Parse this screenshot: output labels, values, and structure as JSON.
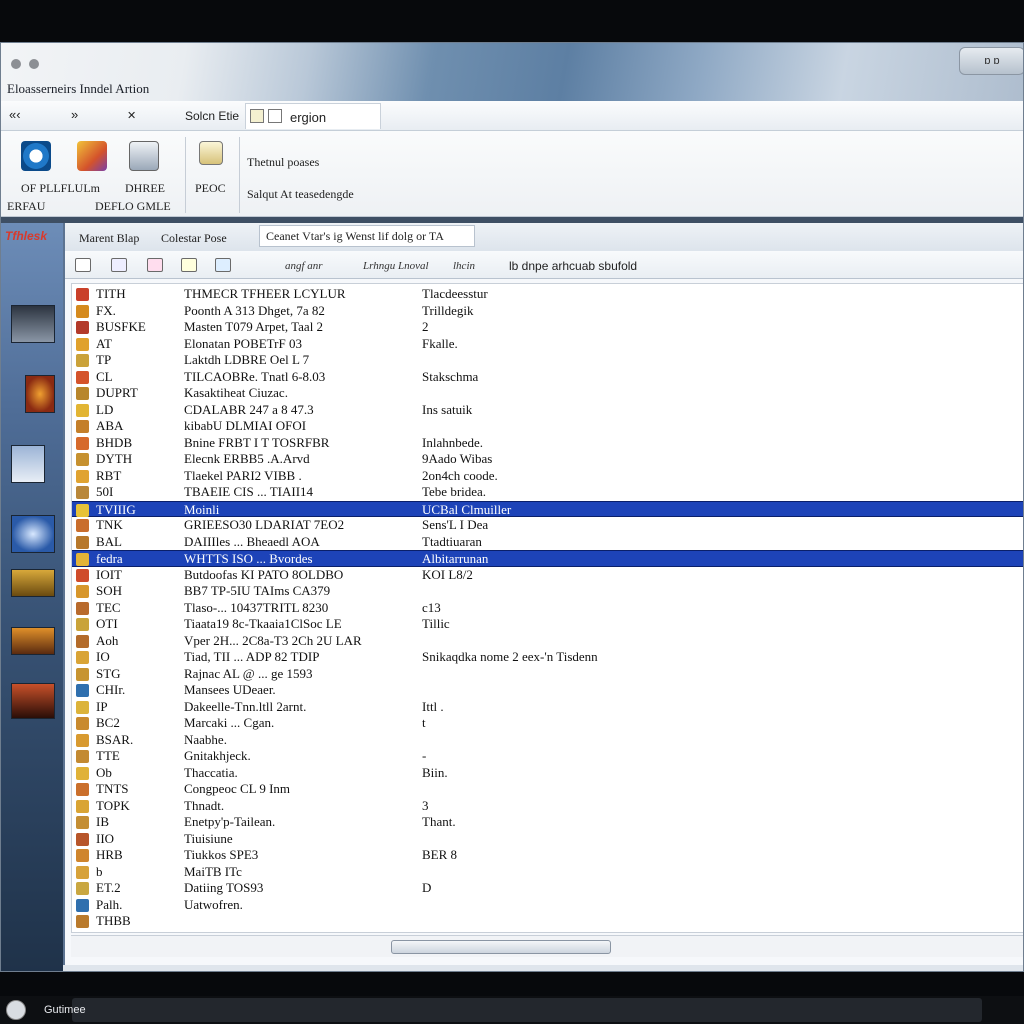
{
  "window": {
    "title": "Eloasserneirs Inndel Artion",
    "controls": "ɒ ɒ"
  },
  "navbar": {
    "back": "«‹",
    "forward": "»",
    "menu": "✕",
    "label": "Solcn Etie",
    "address": "ergion"
  },
  "ribbon": {
    "groups": [
      {
        "label1": "OF PLLFLULm",
        "label2": "ERFAU"
      },
      {
        "label1": "DHREE",
        "label2": "DEFLO GMLE"
      }
    ],
    "mid_label": "PEOC",
    "line1": "Thetnul poases",
    "line2": "Salqut At teasedengde"
  },
  "desktop": {
    "logo": "Tfhlesk"
  },
  "panel": {
    "tabs": [
      "Marent Blap",
      "Colestar Pose"
    ],
    "search": "Ceanet Vtar's ig Wenst lif dolg or TA",
    "tool_labels": [
      "angf anr",
      "Lrhngu Lnoval",
      "lhcin"
    ],
    "tool_right": "lb dnpe arhcuab sbufold"
  },
  "rows": [
    {
      "icon": "#c9402a",
      "c1": "TITH",
      "c2": "THMECR TFHEER LCYLUR",
      "c3": "Tlacdeesstur",
      "selected": false
    },
    {
      "icon": "#d58a1e",
      "c1": "FX.",
      "c2": "Poonth A 313 Dhget, 7a 82",
      "c3": "Trilldegik",
      "selected": false
    },
    {
      "icon": "#b33a2a",
      "c1": "BUSFKE",
      "c2": "Masten T079 Arpet, Taal 2",
      "c3": "2",
      "selected": false
    },
    {
      "icon": "#e0a12c",
      "c1": "AT",
      "c2": "Elonatan POBETrF 03",
      "c3": "Fkalle.",
      "selected": false
    },
    {
      "icon": "#caa23a",
      "c1": "TP",
      "c2": "Laktdh LDBRE Oel L 7",
      "c3": "",
      "selected": false
    },
    {
      "icon": "#d4532b",
      "c1": "CL",
      "c2": "TILCAOBRe. Tnatl 6-8.03",
      "c3": "Stakschma",
      "selected": false
    },
    {
      "icon": "#b8862c",
      "c1": "DUPRT",
      "c2": "Kasaktiheat Ciuzac.",
      "c3": "",
      "selected": false
    },
    {
      "icon": "#e2b534",
      "c1": "LD",
      "c2": "CDALABR 247 a 8 47.3",
      "c3": "Ins satuik",
      "selected": false
    },
    {
      "icon": "#c47f2a",
      "c1": "ABA",
      "c2": "kibabU DLMIAI OFOI",
      "c3": "",
      "selected": false
    },
    {
      "icon": "#d66a2c",
      "c1": "BHDB",
      "c2": "Bnine FRBT I T TOSRFBR",
      "c3": "Inlahnbede.",
      "selected": false
    },
    {
      "icon": "#c69130",
      "c1": "DYTH",
      "c2": "Elecnk ERBB5 .A.Arvd",
      "c3": "9Aado Wibas",
      "selected": false
    },
    {
      "icon": "#e0a331",
      "c1": "RBT",
      "c2": "Tlaekel PARI2 VIBB .",
      "c3": "2on4ch coode.",
      "selected": false
    },
    {
      "icon": "#b9873a",
      "c1": "50I",
      "c2": "TBAEIE CIS ... TIAII14",
      "c3": "Tebe bridea.",
      "selected": false
    },
    {
      "icon": "#e7c238",
      "c1": "TVIIIG",
      "c2": "Moinli",
      "c3": "UCBal Clmuiller",
      "selected": true
    },
    {
      "icon": "#c96d2c",
      "c1": "TNK",
      "c2": "GRIEESO30 LDARIAT 7EO2",
      "c3": "Sens'L I Dea",
      "selected": false
    },
    {
      "icon": "#b7782b",
      "c1": "BAL",
      "c2": "DAIIIles ... Bheaedl AOA",
      "c3": "Ttadtiuaran",
      "selected": false
    },
    {
      "icon": "#e3b337",
      "c1": "fedra",
      "c2": "WHTTS ISO ... Bvordes",
      "c3": "Albitarrunan",
      "selected": true
    },
    {
      "icon": "#cf4c2b",
      "c1": "IOIT",
      "c2": "Butdoofas KI PATO 8OLDBO",
      "c3": "KOI L8/2",
      "selected": false
    },
    {
      "icon": "#d7962b",
      "c1": "SOH",
      "c2": "BB7 TP-5IU TAIms CA379",
      "c3": "",
      "selected": false
    },
    {
      "icon": "#b86a2c",
      "c1": "TEC",
      "c2": "Tlaso-... 10437TRITL 8230",
      "c3": "c13",
      "selected": false
    },
    {
      "icon": "#c9a33a",
      "c1": "OTI",
      "c2": "Tiaata19 8c-Tkaaia1ClSoc LE",
      "c3": "Tillic",
      "selected": false
    },
    {
      "icon": "#b36b2a",
      "c1": "Aoh",
      "c2": "Vper 2H... 2C8a-T3 2Ch 2U LAR",
      "c3": "",
      "selected": false
    },
    {
      "icon": "#d9a436",
      "c1": "IO",
      "c2": "Tiad, TII ... ADP 82 TDIP",
      "c3": "Snikaqdka nome 2 eex-'n Tisdenn",
      "selected": false
    },
    {
      "icon": "#c79431",
      "c1": "STG",
      "c2": "Rajnac AL @ ... ge 1593",
      "c3": "",
      "selected": false
    },
    {
      "icon": "#2f6fae",
      "c1": "CHIr.",
      "c2": "Mansees UDeaer.",
      "c3": "",
      "selected": false
    },
    {
      "icon": "#dcb33a",
      "c1": "IP",
      "c2": "Dakeelle-Tnn.ltll 2arnt.",
      "c3": "Ittl .",
      "selected": false
    },
    {
      "icon": "#c98a2e",
      "c1": "BC2",
      "c2": "Marcaki ... Cgan.",
      "c3": "t",
      "selected": false
    },
    {
      "icon": "#d89a30",
      "c1": "BSAR.",
      "c2": "Naabhe.",
      "c3": "",
      "selected": false
    },
    {
      "icon": "#c38a32",
      "c1": "TTE",
      "c2": "Gnitakhjeck.",
      "c3": "-",
      "selected": false
    },
    {
      "icon": "#e0b238",
      "c1": "Ob",
      "c2": "Thaccatia.",
      "c3": "Biin.",
      "selected": false
    },
    {
      "icon": "#ca6f2c",
      "c1": "TNTS",
      "c2": "Congpeoc CL 9 Inm",
      "c3": "",
      "selected": false
    },
    {
      "icon": "#d9a434",
      "c1": "TOPK",
      "c2": "Thnadt.",
      "c3": "3",
      "selected": false
    },
    {
      "icon": "#c48e34",
      "c1": "IB",
      "c2": "Enetpy'p-Tailean.",
      "c3": "Thant.",
      "selected": false
    },
    {
      "icon": "#b7552a",
      "c1": "IIO",
      "c2": "Tiuisiune",
      "c3": "",
      "selected": false
    },
    {
      "icon": "#cf852d",
      "c1": "HRB",
      "c2": "Tiukkos SPE3",
      "c3": "BER 8",
      "selected": false
    },
    {
      "icon": "#d7a23a",
      "c1": "b",
      "c2": "MaiTB ITc",
      "c3": "",
      "selected": false
    },
    {
      "icon": "#c9a741",
      "c1": "ET.2",
      "c2": "Datiing TOS93",
      "c3": "D",
      "selected": false
    },
    {
      "icon": "#2f6fae",
      "c1": "Palh.",
      "c2": "Uatwofren.",
      "c3": "",
      "selected": false
    },
    {
      "icon": "#b97a2c",
      "c1": "THBB",
      "c2": "",
      "c3": "",
      "selected": false
    }
  ],
  "taskbar": {
    "label": "Gutimee"
  },
  "colors": {
    "selection": "#1d43b8",
    "titlebar_accent": "#5d7fa3"
  }
}
